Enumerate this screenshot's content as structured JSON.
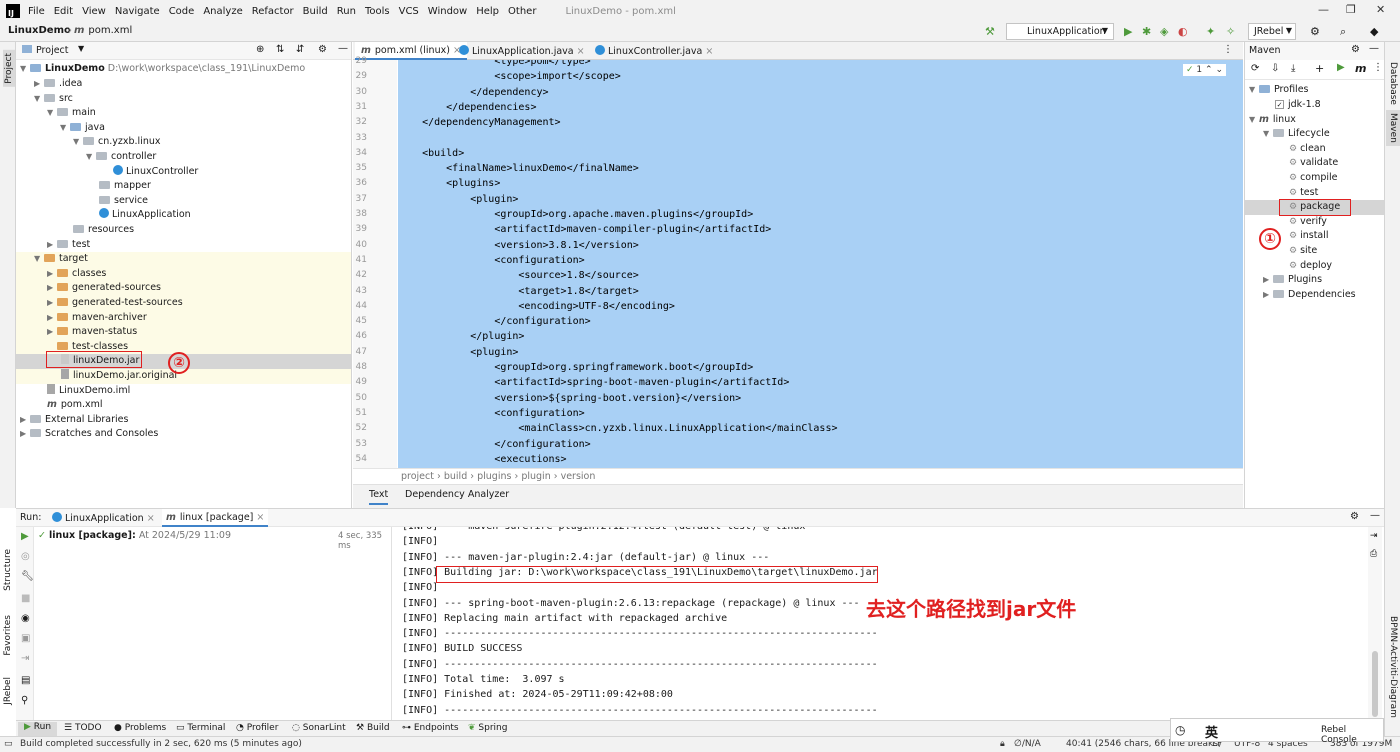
{
  "menu": {
    "items": [
      "File",
      "Edit",
      "View",
      "Navigate",
      "Code",
      "Analyze",
      "Refactor",
      "Build",
      "Run",
      "Tools",
      "VCS",
      "Window",
      "Help",
      "Other"
    ],
    "window_title": "LinuxDemo - pom.xml"
  },
  "toolbar": {
    "project_crumb": "LinuxDemo",
    "file_crumb": "pom.xml",
    "run_config": "LinuxApplication",
    "jrebel": "JRebel"
  },
  "project_panel": {
    "title": "Project",
    "tree": [
      {
        "label": "LinuxDemo",
        "path": "D:\\work\\workspace\\class_191\\LinuxDemo"
      },
      {
        "label": ".idea"
      },
      {
        "label": "src"
      },
      {
        "label": "main"
      },
      {
        "label": "java"
      },
      {
        "label": "cn.yzxb.linux"
      },
      {
        "label": "controller"
      },
      {
        "label": "LinuxController"
      },
      {
        "label": "mapper"
      },
      {
        "label": "service"
      },
      {
        "label": "LinuxApplication"
      },
      {
        "label": "resources"
      },
      {
        "label": "test"
      },
      {
        "label": "target"
      },
      {
        "label": "classes"
      },
      {
        "label": "generated-sources"
      },
      {
        "label": "generated-test-sources"
      },
      {
        "label": "maven-archiver"
      },
      {
        "label": "maven-status"
      },
      {
        "label": "test-classes"
      },
      {
        "label": "linuxDemo.jar"
      },
      {
        "label": "linuxDemo.jar.original"
      },
      {
        "label": "LinuxDemo.iml"
      },
      {
        "label": "pom.xml"
      },
      {
        "label": "External Libraries"
      },
      {
        "label": "Scratches and Consoles"
      }
    ]
  },
  "editor": {
    "tabs": [
      "pom.xml (linux)",
      "LinuxApplication.java",
      "LinuxController.java"
    ],
    "inspection": "1",
    "line_numbers": [
      "29",
      "29",
      "30",
      "31",
      "32",
      "33",
      "34",
      "35",
      "36",
      "37",
      "38",
      "39",
      "40",
      "41",
      "42",
      "43",
      "44",
      "45",
      "46",
      "47",
      "48",
      "49",
      "50",
      "51",
      "52",
      "53",
      "54"
    ],
    "code_lines": [
      "                <type>pom</type>",
      "                <scope>import</scope>",
      "            </dependency>",
      "        </dependencies>",
      "    </dependencyManagement>",
      "",
      "    <build>",
      "        <finalName>linuxDemo</finalName>",
      "        <plugins>",
      "            <plugin>",
      "                <groupId>org.apache.maven.plugins</groupId>",
      "                <artifactId>maven-compiler-plugin</artifactId>",
      "                <version>3.8.1</version>",
      "                <configuration>",
      "                    <source>1.8</source>",
      "                    <target>1.8</target>",
      "                    <encoding>UTF-8</encoding>",
      "                </configuration>",
      "            </plugin>",
      "            <plugin>",
      "                <groupId>org.springframework.boot</groupId>",
      "                <artifactId>spring-boot-maven-plugin</artifactId>",
      "                <version>${spring-boot.version}</version>",
      "                <configuration>",
      "                    <mainClass>cn.yzxb.linux.LinuxApplication</mainClass>",
      "                </configuration>",
      "                <executions>"
    ],
    "breadcrumb": [
      "project",
      "build",
      "plugins",
      "plugin",
      "version"
    ],
    "bottom_tabs": [
      "Text",
      "Dependency Analyzer"
    ]
  },
  "maven_panel": {
    "title": "Maven",
    "tree": [
      {
        "label": "Profiles"
      },
      {
        "label": "jdk-1.8"
      },
      {
        "label": "linux"
      },
      {
        "label": "Lifecycle"
      },
      {
        "label": "clean"
      },
      {
        "label": "validate"
      },
      {
        "label": "compile"
      },
      {
        "label": "test"
      },
      {
        "label": "package"
      },
      {
        "label": "verify"
      },
      {
        "label": "install"
      },
      {
        "label": "site"
      },
      {
        "label": "deploy"
      },
      {
        "label": "Plugins"
      },
      {
        "label": "Dependencies"
      }
    ]
  },
  "annotations": {
    "circle1": "①",
    "circle2": "②",
    "note": "去这个路径找到jar文件"
  },
  "run_panel": {
    "label": "Run:",
    "tabs": [
      "LinuxApplication",
      "linux [package]"
    ],
    "task_name": "linux [package]:",
    "task_time": "At 2024/5/29 11:09",
    "task_duration": "4 sec, 335 ms",
    "console": [
      "[INFO] --- maven-surefire-plugin:2.12.4:test (default-test) @ linux ---",
      "[INFO]",
      "[INFO] --- maven-jar-plugin:2.4:jar (default-jar) @ linux ---",
      "[INFO] Building jar: D:\\work\\workspace\\class_191\\LinuxDemo\\target\\linuxDemo.jar",
      "[INFO]",
      "[INFO] --- spring-boot-maven-plugin:2.6.13:repackage (repackage) @ linux ---",
      "[INFO] Replacing main artifact with repackaged archive",
      "[INFO] ------------------------------------------------------------------------",
      "[INFO] BUILD SUCCESS",
      "[INFO] ------------------------------------------------------------------------",
      "[INFO] Total time:  3.097 s",
      "[INFO] Finished at: 2024-05-29T11:09:42+08:00",
      "[INFO] ------------------------------------------------------------------------"
    ]
  },
  "tool_tabs": [
    "Run",
    "TODO",
    "Problems",
    "Terminal",
    "Profiler",
    "SonarLint",
    "Build",
    "Endpoints",
    "Spring"
  ],
  "side_strips": {
    "left": [
      "Project",
      "Structure",
      "Favorites",
      "JRebel"
    ],
    "right": [
      "Database",
      "Maven",
      "BPMN-Activiti-Diagram"
    ]
  },
  "status": {
    "message": "Build completed successfully in 2 sec, 620 ms (5 minutes ago)",
    "na": "∅/N/A",
    "position": "40:41 (2546 chars, 66 line breaks)",
    "line_sep": "LF",
    "encoding": "UTF-8",
    "indent": "4 spaces",
    "memory": "383 of 1979M",
    "ime": "英",
    "jrebel_console": "Rebel Console"
  }
}
